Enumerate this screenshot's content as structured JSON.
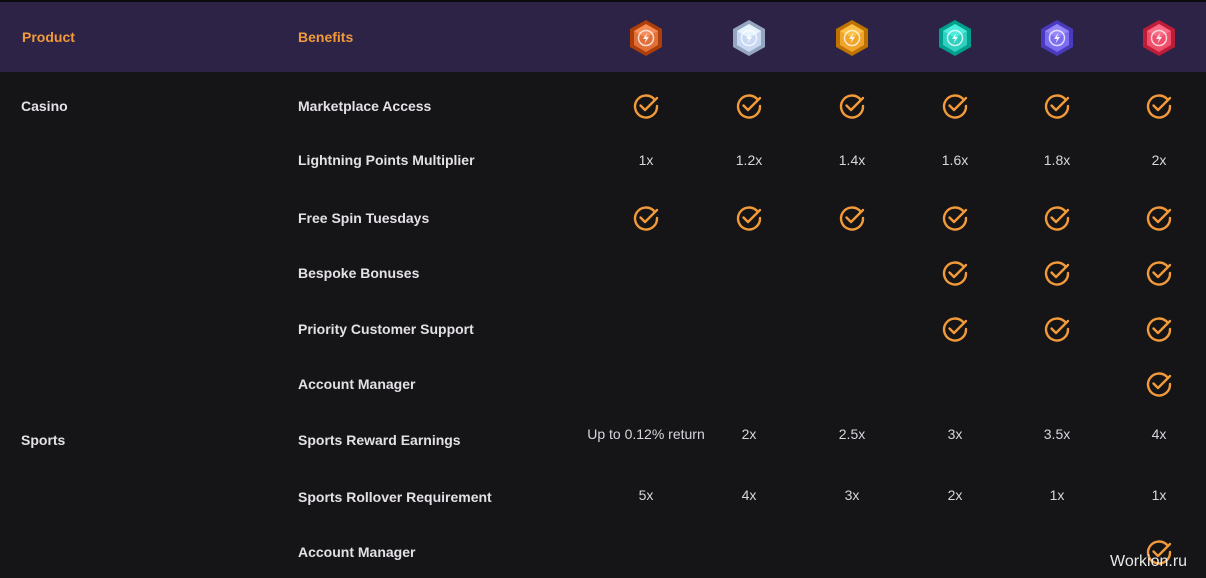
{
  "header": {
    "product_label": "Product",
    "benefits_label": "Benefits",
    "tiers": [
      {
        "icon": "bronze-gem-icon",
        "color": "#e0703a"
      },
      {
        "icon": "silver-gem-icon",
        "color": "#c9d8f2"
      },
      {
        "icon": "gold-gem-icon",
        "color": "#f0a42a"
      },
      {
        "icon": "platinum-gem-icon",
        "color": "#2fd0bf"
      },
      {
        "icon": "diamond-gem-icon",
        "color": "#7b6cf0"
      },
      {
        "icon": "ruby-gem-icon",
        "color": "#ef4f6a"
      }
    ]
  },
  "colors": {
    "accent": "#f29a3a",
    "header_bg": "#2c2347",
    "page_bg": "#151416"
  },
  "rows": [
    {
      "product": "Casino",
      "benefit": "Marketplace Access",
      "cells": [
        {
          "check": true
        },
        {
          "check": true
        },
        {
          "check": true
        },
        {
          "check": true
        },
        {
          "check": true
        },
        {
          "check": true
        }
      ]
    },
    {
      "product": "",
      "benefit": "Lightning Points Multiplier",
      "cells": [
        {
          "text": "1x"
        },
        {
          "text": "1.2x"
        },
        {
          "text": "1.4x"
        },
        {
          "text": "1.6x"
        },
        {
          "text": "1.8x"
        },
        {
          "text": "2x"
        }
      ]
    },
    {
      "product": "",
      "benefit": "Free Spin Tuesdays",
      "cells": [
        {
          "check": true
        },
        {
          "check": true
        },
        {
          "check": true
        },
        {
          "check": true
        },
        {
          "check": true
        },
        {
          "check": true
        }
      ]
    },
    {
      "product": "",
      "benefit": "Bespoke Bonuses",
      "cells": [
        {},
        {},
        {},
        {
          "check": true
        },
        {
          "check": true
        },
        {
          "check": true
        }
      ]
    },
    {
      "product": "",
      "benefit": "Priority Customer Support",
      "cells": [
        {},
        {},
        {},
        {
          "check": true
        },
        {
          "check": true
        },
        {
          "check": true
        }
      ]
    },
    {
      "product": "",
      "benefit": "Account Manager",
      "cells": [
        {},
        {},
        {},
        {},
        {},
        {
          "check": true
        }
      ]
    },
    {
      "product": "Sports",
      "benefit": "Sports Reward Earnings",
      "cells": [
        {
          "text": "Up to 0.12% return"
        },
        {
          "text": "2x"
        },
        {
          "text": "2.5x"
        },
        {
          "text": "3x"
        },
        {
          "text": "3.5x"
        },
        {
          "text": "4x"
        }
      ]
    },
    {
      "product": "",
      "benefit": "Sports Rollover Requirement",
      "cells": [
        {
          "text": "5x"
        },
        {
          "text": "4x"
        },
        {
          "text": "3x"
        },
        {
          "text": "2x"
        },
        {
          "text": "1x"
        },
        {
          "text": "1x"
        }
      ]
    },
    {
      "product": "",
      "benefit": "Account Manager",
      "cells": [
        {},
        {},
        {},
        {},
        {},
        {
          "check": true
        }
      ]
    }
  ],
  "watermark": "Workion.ru"
}
